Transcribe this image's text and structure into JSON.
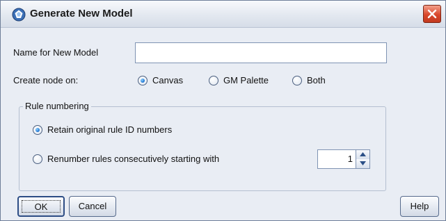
{
  "window": {
    "title": "Generate New Model",
    "icon": "model-nugget-icon",
    "close_icon": "close-icon"
  },
  "form": {
    "name_label": "Name for New Model",
    "name_value": "",
    "create_node_label": "Create node on:",
    "create_node_options": [
      {
        "label": "Canvas",
        "checked": true
      },
      {
        "label": "GM Palette",
        "checked": false
      },
      {
        "label": "Both",
        "checked": false
      }
    ]
  },
  "rule_numbering": {
    "title": "Rule numbering",
    "options": [
      {
        "label": "Retain original rule ID numbers",
        "checked": true
      },
      {
        "label": "Renumber rules consecutively starting with",
        "checked": false
      }
    ],
    "start_value": "1"
  },
  "buttons": {
    "ok": "OK",
    "cancel": "Cancel",
    "help": "Help"
  },
  "colors": {
    "accent": "#1a6fcf",
    "close_button": "#d8472b"
  }
}
